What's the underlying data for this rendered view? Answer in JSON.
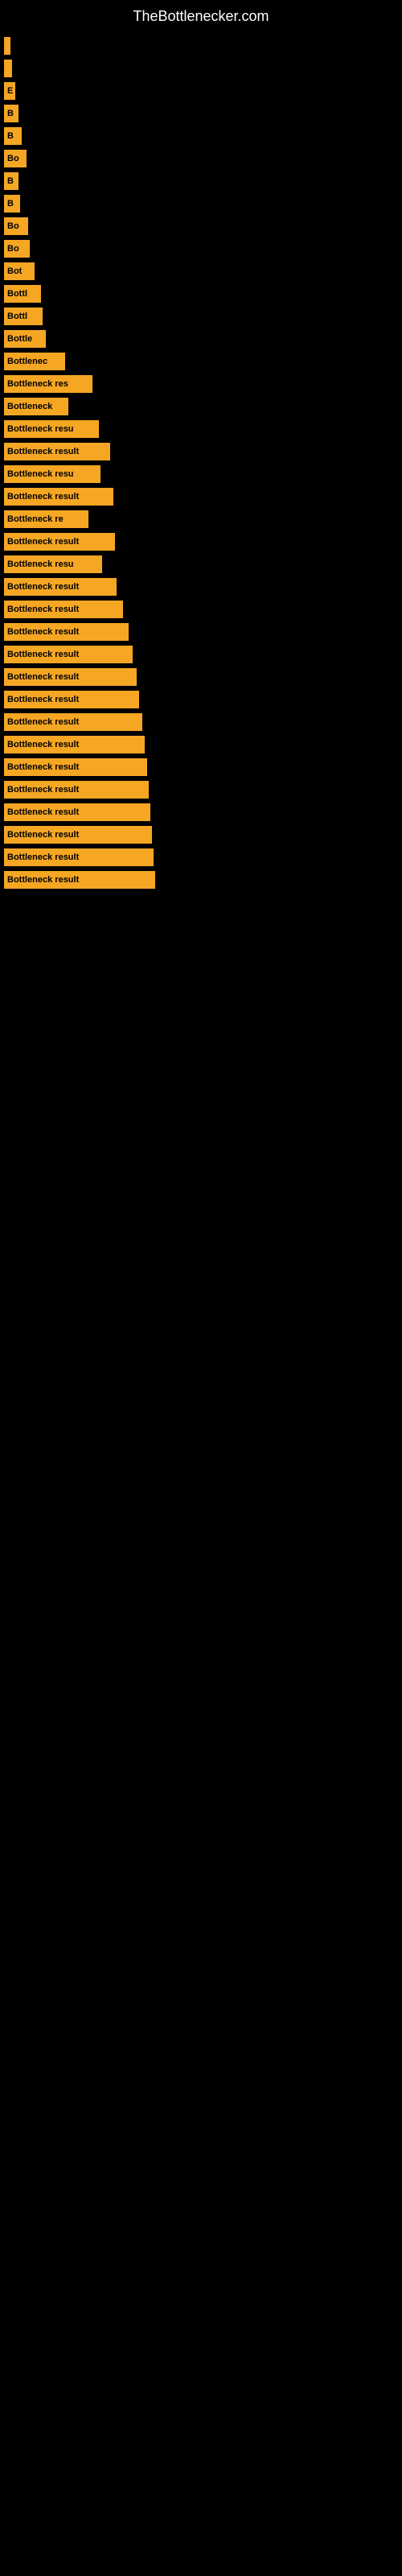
{
  "header": {
    "title": "TheBottlenecker.com"
  },
  "bars": [
    {
      "label": "",
      "width": 8
    },
    {
      "label": "",
      "width": 10
    },
    {
      "label": "E",
      "width": 14
    },
    {
      "label": "B",
      "width": 18
    },
    {
      "label": "B",
      "width": 22
    },
    {
      "label": "Bo",
      "width": 28
    },
    {
      "label": "B",
      "width": 18
    },
    {
      "label": "B",
      "width": 20
    },
    {
      "label": "Bo",
      "width": 30
    },
    {
      "label": "Bo",
      "width": 32
    },
    {
      "label": "Bot",
      "width": 38
    },
    {
      "label": "Bottl",
      "width": 46
    },
    {
      "label": "Bottl",
      "width": 48
    },
    {
      "label": "Bottle",
      "width": 52
    },
    {
      "label": "Bottlenec",
      "width": 76
    },
    {
      "label": "Bottleneck res",
      "width": 110
    },
    {
      "label": "Bottleneck",
      "width": 80
    },
    {
      "label": "Bottleneck resu",
      "width": 118
    },
    {
      "label": "Bottleneck result",
      "width": 132
    },
    {
      "label": "Bottleneck resu",
      "width": 120
    },
    {
      "label": "Bottleneck result",
      "width": 136
    },
    {
      "label": "Bottleneck re",
      "width": 105
    },
    {
      "label": "Bottleneck result",
      "width": 138
    },
    {
      "label": "Bottleneck resu",
      "width": 122
    },
    {
      "label": "Bottleneck result",
      "width": 140
    },
    {
      "label": "Bottleneck result",
      "width": 148
    },
    {
      "label": "Bottleneck result",
      "width": 155
    },
    {
      "label": "Bottleneck result",
      "width": 160
    },
    {
      "label": "Bottleneck result",
      "width": 165
    },
    {
      "label": "Bottleneck result",
      "width": 168
    },
    {
      "label": "Bottleneck result",
      "width": 172
    },
    {
      "label": "Bottleneck result",
      "width": 175
    },
    {
      "label": "Bottleneck result",
      "width": 178
    },
    {
      "label": "Bottleneck result",
      "width": 180
    },
    {
      "label": "Bottleneck result",
      "width": 182
    },
    {
      "label": "Bottleneck result",
      "width": 184
    },
    {
      "label": "Bottleneck result",
      "width": 186
    },
    {
      "label": "Bottleneck result",
      "width": 188
    }
  ]
}
